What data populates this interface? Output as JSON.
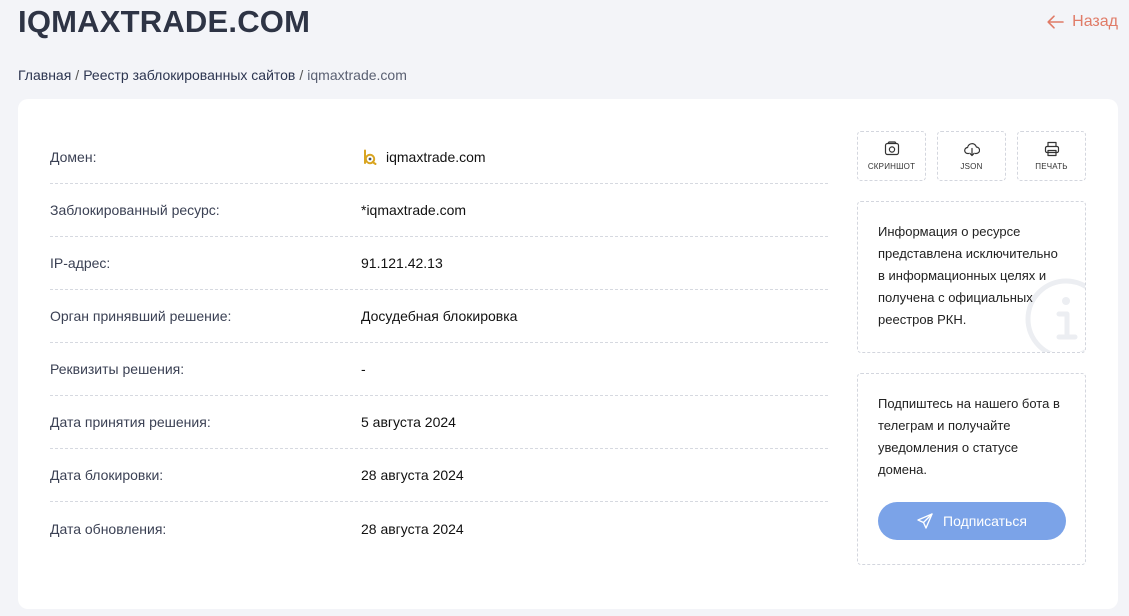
{
  "header": {
    "title": "IQMAXTRADE.COM",
    "back_label": "Назад"
  },
  "breadcrumb": {
    "home": "Главная",
    "registry": "Реестр заблокированных сайтов",
    "current": "iqmaxtrade.com",
    "separator": "/"
  },
  "details": [
    {
      "label": "Домен:",
      "value": "iqmaxtrade.com"
    },
    {
      "label": "Заблокированный ресурс:",
      "value": "*iqmaxtrade.com"
    },
    {
      "label": "IP-адрес:",
      "value": "91.121.42.13"
    },
    {
      "label": "Орган принявший решение:",
      "value": "Досудебная блокировка"
    },
    {
      "label": "Реквизиты решения:",
      "value": "-"
    },
    {
      "label": "Дата принятия решения:",
      "value": "5 августа 2024"
    },
    {
      "label": "Дата блокировки:",
      "value": "28 августа 2024"
    },
    {
      "label": "Дата обновления:",
      "value": "28 августа 2024"
    }
  ],
  "tools": {
    "screenshot": {
      "label": "СКРИНШОТ",
      "icon": "camera-icon"
    },
    "json": {
      "label": "JSON",
      "icon": "cloud-download-icon"
    },
    "print": {
      "label": "ПЕЧАТЬ",
      "icon": "printer-icon"
    }
  },
  "notice": {
    "text": "Информация о ресурсе представлена исключительно в информационных целях и получена с официальных реестров РКН.",
    "icon": "info-icon"
  },
  "subscribe": {
    "text": "Подпиштесь на нашего бота в телеграм и получайте уведомления о статусе домена.",
    "button_label": "Подписаться",
    "icon": "send-icon"
  },
  "colors": {
    "background": "#f3f4f8",
    "title": "#2e3445",
    "back_link": "#e07b67",
    "subscribe_button": "#7ba3e8",
    "favicon": "#d9a521"
  }
}
